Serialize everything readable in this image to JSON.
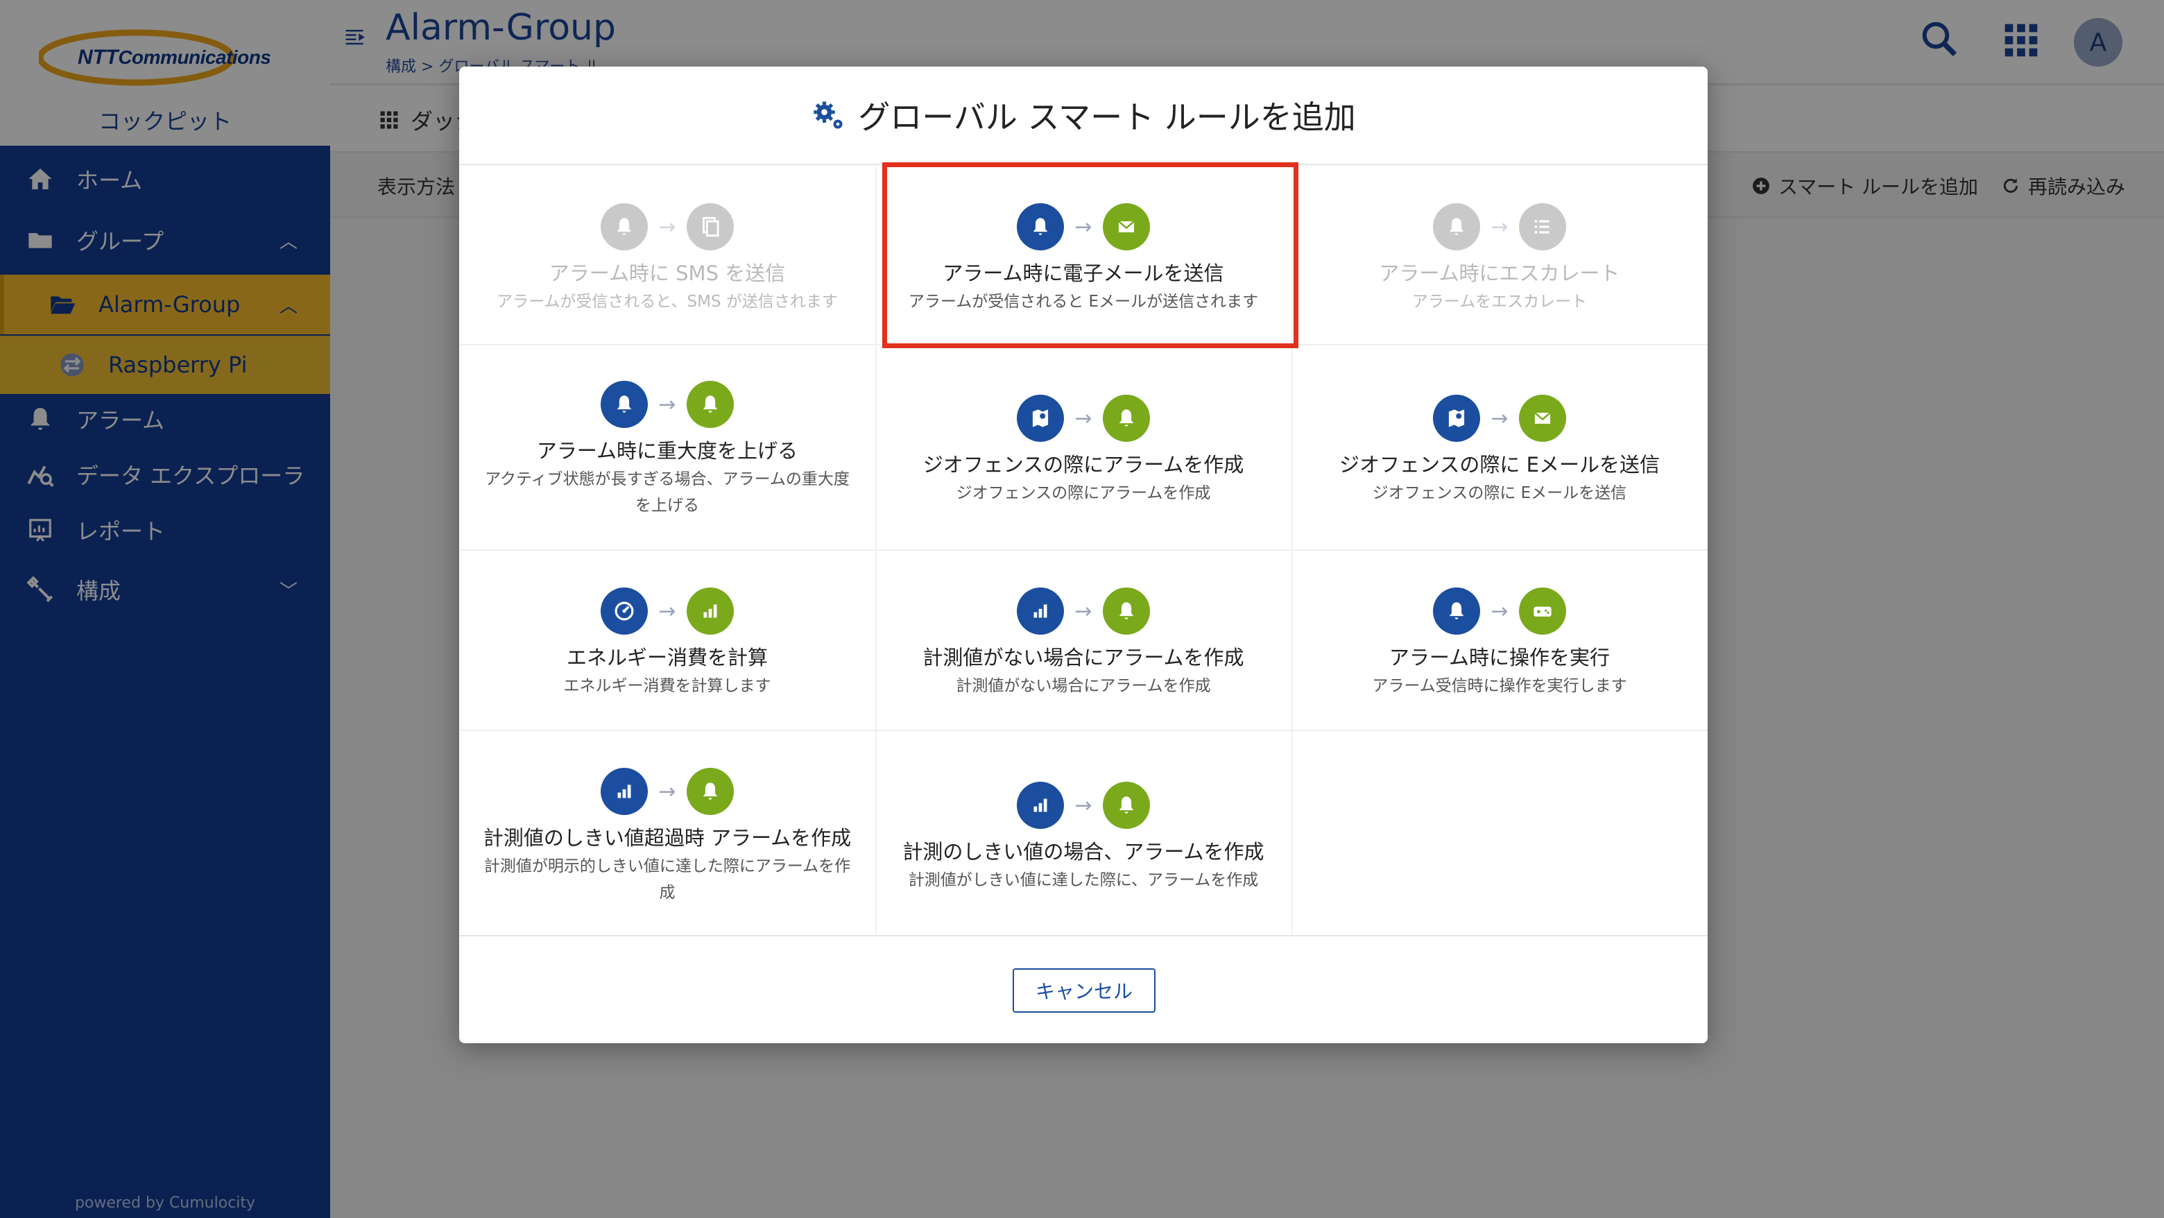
{
  "app": {
    "logo_text_1": "NTT",
    "logo_text_2": "Communications",
    "app_name": "コックピット",
    "powered_by": "powered by Cumulocity"
  },
  "sidebar": {
    "items": [
      {
        "label": "ホーム",
        "icon": "home-icon"
      },
      {
        "label": "グループ",
        "icon": "folder-icon"
      },
      {
        "label": "Alarm-Group",
        "icon": "folder-open-icon"
      },
      {
        "label": "Raspberry Pi",
        "icon": "device-icon"
      },
      {
        "label": "アラーム",
        "icon": "bell-icon"
      },
      {
        "label": "データ エクスプローラ",
        "icon": "data-explorer-icon"
      },
      {
        "label": "レポート",
        "icon": "report-icon"
      },
      {
        "label": "構成",
        "icon": "wrench-icon"
      }
    ]
  },
  "header": {
    "title": "Alarm-Group",
    "breadcrumb": "構成 > グローバル スマート ル..."
  },
  "user": {
    "initial": "A"
  },
  "tabs": {
    "dashboard": "ダッシ"
  },
  "actions": {
    "view_mode": "表示方法",
    "add_rule": "スマート ルールを追加",
    "reload": "再読み込み"
  },
  "modal": {
    "title": "グローバル スマート ルールを追加",
    "cancel": "キャンセル",
    "rules": [
      {
        "title": "アラーム時に SMS を送信",
        "desc": "アラームが受信されると、SMS が送信されます",
        "from": "bell",
        "to": "copy",
        "disabled": true
      },
      {
        "title": "アラーム時に電子メールを送信",
        "desc": "アラームが受信されると Eメールが送信されます",
        "from": "bell",
        "to": "mail",
        "disabled": false
      },
      {
        "title": "アラーム時にエスカレート",
        "desc": "アラームをエスカレート",
        "from": "bell",
        "to": "list",
        "disabled": true
      },
      {
        "title": "アラーム時に重大度を上げる",
        "desc": "アクティブ状態が長すぎる場合、アラームの重大度を上げる",
        "from": "bell",
        "to": "bell"
      },
      {
        "title": "ジオフェンスの際にアラームを作成",
        "desc": "ジオフェンスの際にアラームを作成",
        "from": "map",
        "to": "bell"
      },
      {
        "title": "ジオフェンスの際に Eメールを送信",
        "desc": "ジオフェンスの際に Eメールを送信",
        "from": "map",
        "to": "mail"
      },
      {
        "title": "エネルギー消費を計算",
        "desc": "エネルギー消費を計算します",
        "from": "gauge",
        "to": "chart"
      },
      {
        "title": "計測値がない場合にアラームを作成",
        "desc": "計測値がない場合にアラームを作成",
        "from": "chart",
        "to": "bell"
      },
      {
        "title": "アラーム時に操作を実行",
        "desc": "アラーム受信時に操作を実行します",
        "from": "bell",
        "to": "gamepad"
      },
      {
        "title": "計測値のしきい値超過時 アラームを作成",
        "desc": "計測値が明示的しきい値に達した際にアラームを作成",
        "from": "chart",
        "to": "bell"
      },
      {
        "title": "計測のしきい値の場合、アラームを作成",
        "desc": "計測値がしきい値に達した際に、アラームを作成",
        "from": "chart",
        "to": "bell"
      }
    ]
  },
  "colors": {
    "sidebar": "#133d95",
    "active": "#f8be2d",
    "blue_icon": "#1b4e9e",
    "green_icon": "#7aa91c",
    "highlight": "#e1301c"
  }
}
